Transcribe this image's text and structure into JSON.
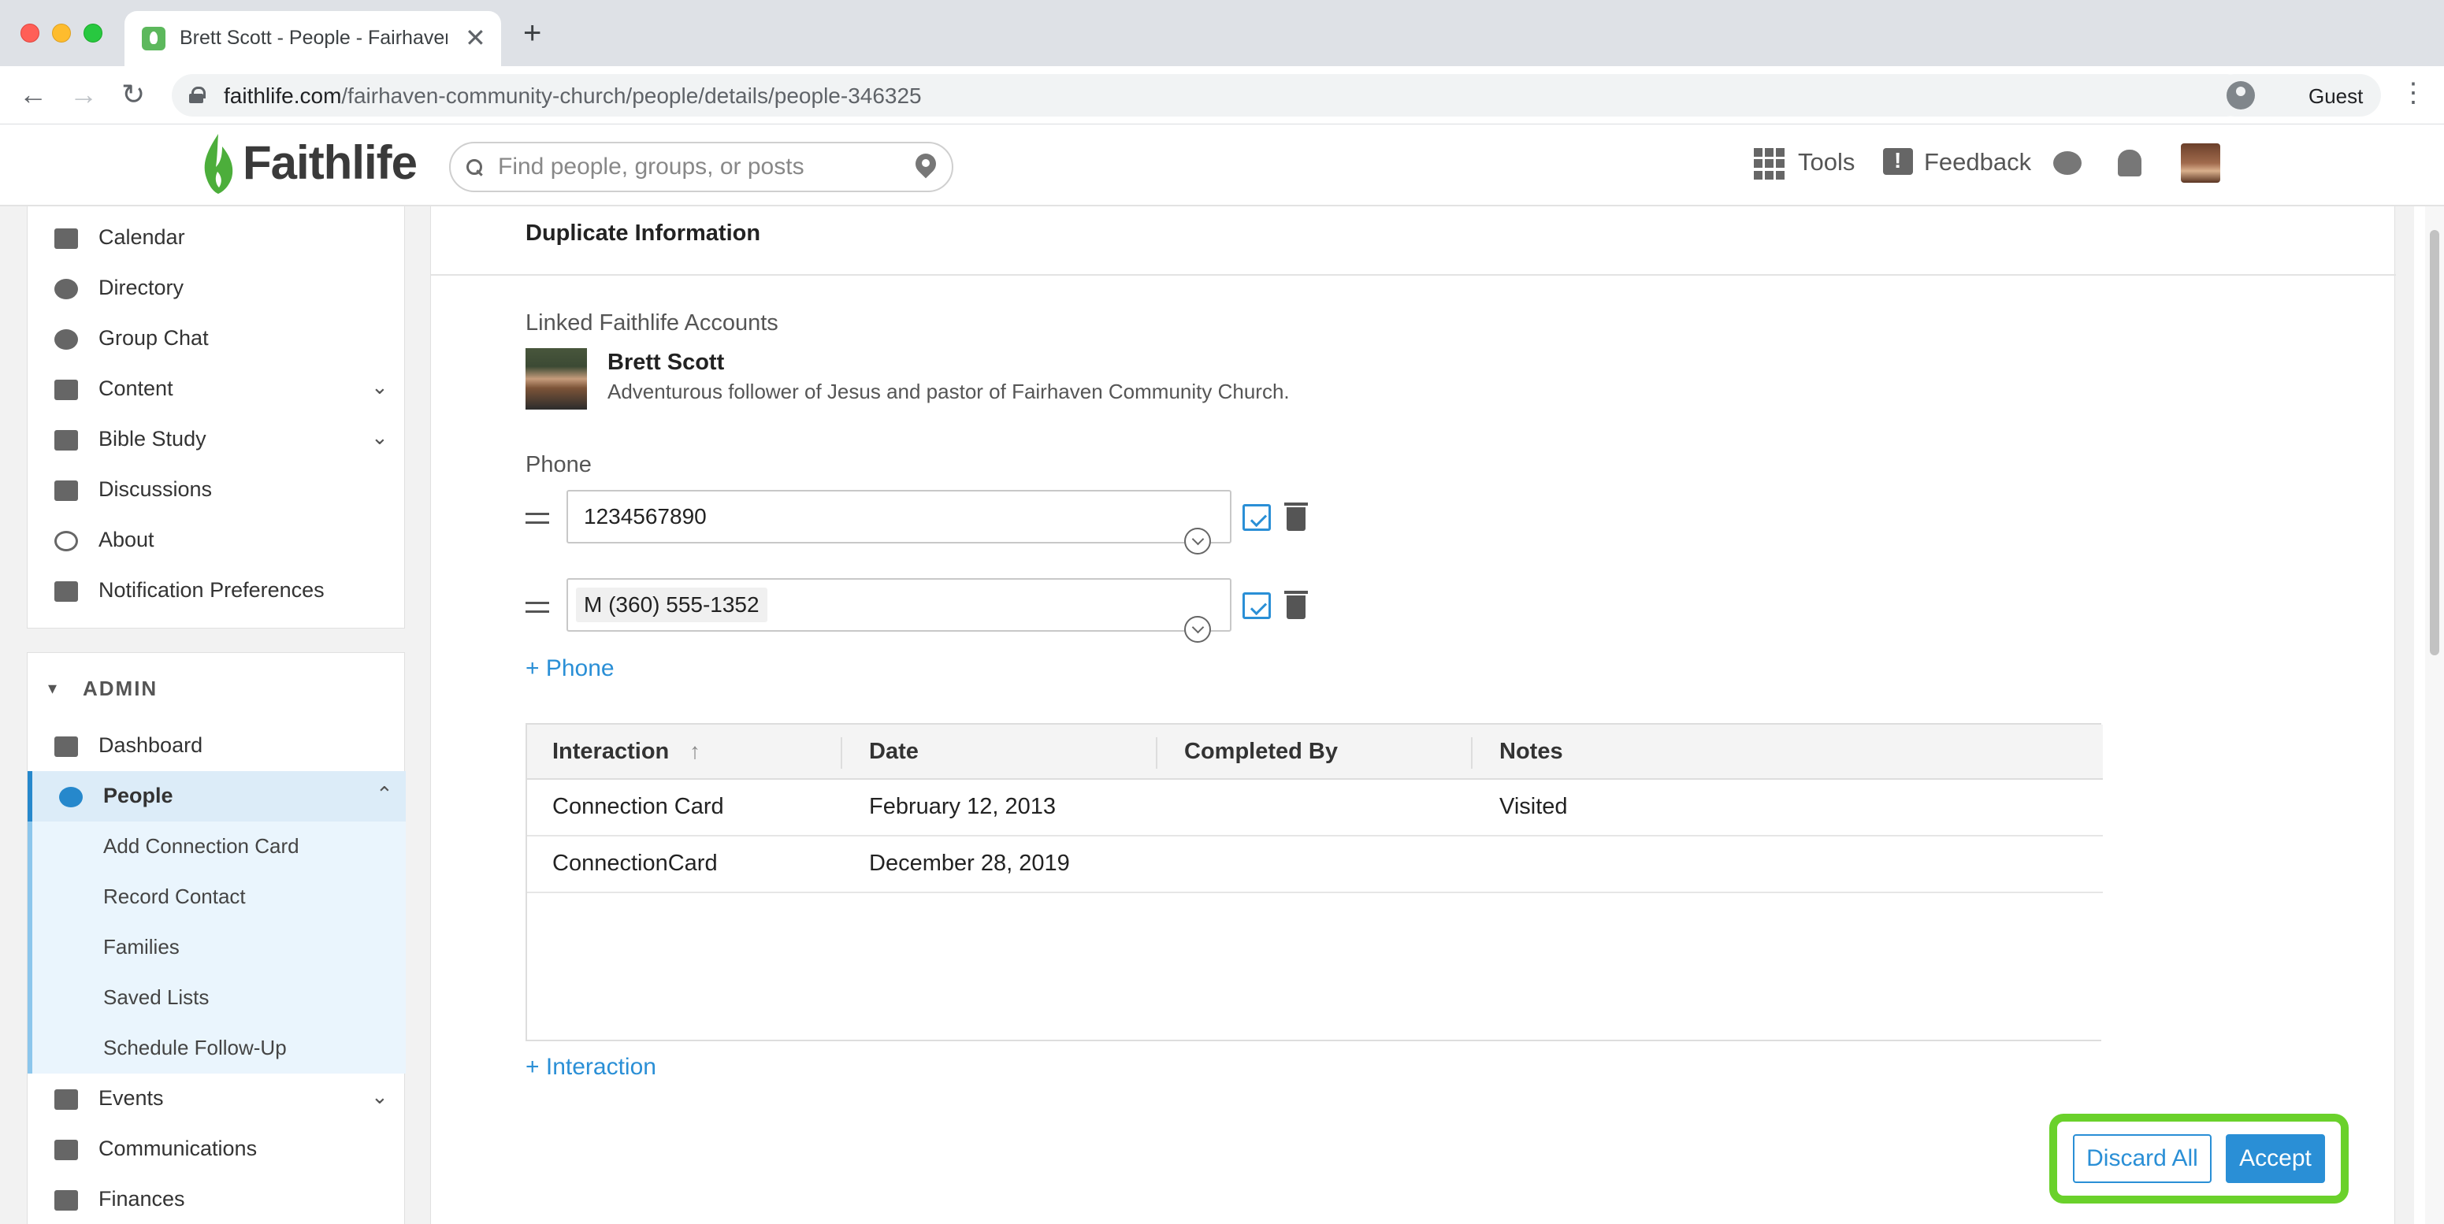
{
  "browser": {
    "tab_title": "Brett Scott - People - Fairhaven",
    "url_host": "faithlife.com",
    "url_path": "/fairhaven-community-church/people/details/people-346325",
    "profile_label": "Guest"
  },
  "header": {
    "logo": "Faithlife",
    "search_placeholder": "Find people, groups, or posts",
    "tools_label": "Tools",
    "feedback_label": "Feedback"
  },
  "sidebar": {
    "items": [
      {
        "label": "Calendar",
        "icon": "calendar-icon"
      },
      {
        "label": "Directory",
        "icon": "people-icon"
      },
      {
        "label": "Group Chat",
        "icon": "chat-icon"
      },
      {
        "label": "Content",
        "icon": "folder-icon",
        "expandable": true
      },
      {
        "label": "Bible Study",
        "icon": "bible-icon",
        "expandable": true
      },
      {
        "label": "Discussions",
        "icon": "discussions-icon"
      },
      {
        "label": "About",
        "icon": "info-icon"
      },
      {
        "label": "Notification Preferences",
        "icon": "bell-icon"
      }
    ],
    "admin": {
      "label": "ADMIN",
      "dashboard": "Dashboard",
      "people": "People",
      "people_sub": [
        "Add Connection Card",
        "Record Contact",
        "Families",
        "Saved Lists",
        "Schedule Follow-Up"
      ],
      "events": "Events",
      "communications": "Communications",
      "finances": "Finances"
    }
  },
  "main": {
    "section_title": "Duplicate Information",
    "linked_accounts_label": "Linked Faithlife Accounts",
    "account": {
      "name": "Brett Scott",
      "bio": "Adventurous follower of Jesus and pastor of Fairhaven Community Church."
    },
    "phone_label": "Phone",
    "phones": [
      "1234567890",
      "M (360) 555-1352"
    ],
    "add_phone": "+ Phone",
    "interactions": {
      "columns": [
        "Interaction",
        "Date",
        "Completed By",
        "Notes"
      ],
      "rows": [
        {
          "interaction": "Connection Card",
          "date": "February 12, 2013",
          "completed_by": "",
          "notes": "Visited"
        },
        {
          "interaction": "ConnectionCard",
          "date": "December 28, 2019",
          "completed_by": "",
          "notes": ""
        }
      ]
    },
    "add_interaction": "+ Interaction",
    "discard_label": "Discard All",
    "accept_label": "Accept"
  },
  "colors": {
    "accent": "#2a8fd6",
    "brand_green": "#5cb85c",
    "highlight_box": "#6ad12b"
  }
}
